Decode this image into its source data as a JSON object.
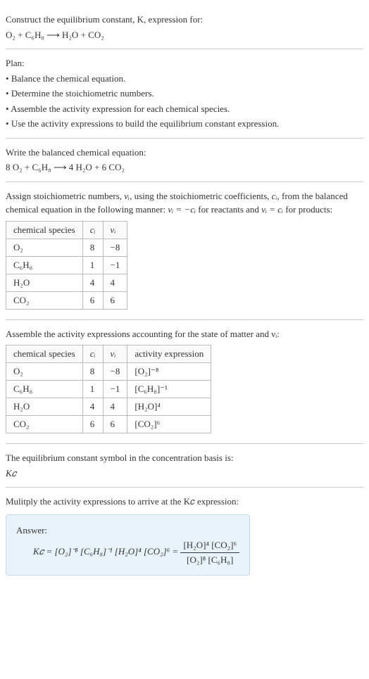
{
  "intro": {
    "title": "Construct the equilibrium constant, K, expression for:",
    "equation": "O₂ + C₆H₈ ⟶ H₂O + CO₂"
  },
  "plan": {
    "heading": "Plan:",
    "bullets": [
      "Balance the chemical equation.",
      "Determine the stoichiometric numbers.",
      "Assemble the activity expression for each chemical species.",
      "Use the activity expressions to build the equilibrium constant expression."
    ]
  },
  "balanced": {
    "heading": "Write the balanced chemical equation:",
    "equation": "8 O₂ + C₆H₈ ⟶ 4 H₂O + 6 CO₂"
  },
  "stoich": {
    "intro_a": "Assign stoichiometric numbers, ",
    "nu": "νᵢ",
    "intro_b": ", using the stoichiometric coefficients, ",
    "ci": "cᵢ",
    "intro_c": ", from the balanced chemical equation in the following manner: ",
    "rel1": "νᵢ = −cᵢ",
    "intro_d": " for reactants and ",
    "rel2": "νᵢ = cᵢ",
    "intro_e": " for products:",
    "headers": [
      "chemical species",
      "cᵢ",
      "νᵢ"
    ],
    "rows": [
      [
        "O₂",
        "8",
        "−8"
      ],
      [
        "C₆H₈",
        "1",
        "−1"
      ],
      [
        "H₂O",
        "4",
        "4"
      ],
      [
        "CO₂",
        "6",
        "6"
      ]
    ]
  },
  "activity": {
    "intro": "Assemble the activity expressions accounting for the state of matter and νᵢ:",
    "headers": [
      "chemical species",
      "cᵢ",
      "νᵢ",
      "activity expression"
    ],
    "rows": [
      [
        "O₂",
        "8",
        "−8",
        "[O₂]⁻⁸"
      ],
      [
        "C₆H₈",
        "1",
        "−1",
        "[C₆H₈]⁻¹"
      ],
      [
        "H₂O",
        "4",
        "4",
        "[H₂O]⁴"
      ],
      [
        "CO₂",
        "6",
        "6",
        "[CO₂]⁶"
      ]
    ]
  },
  "symbol": {
    "line1": "The equilibrium constant symbol in the concentration basis is:",
    "kc": "K𝑐"
  },
  "multiply": {
    "intro": "Mulitply the activity expressions to arrive at the K𝑐 expression:",
    "answer_label": "Answer:",
    "kc_eq": "K𝑐 = [O₂]⁻⁸ [C₆H₈]⁻¹ [H₂O]⁴ [CO₂]⁶ = ",
    "frac_num": "[H₂O]⁴ [CO₂]⁶",
    "frac_den": "[O₂]⁸ [C₆H₈]"
  },
  "chart_data": {
    "type": "table",
    "tables": [
      {
        "title": "Stoichiometric numbers",
        "columns": [
          "chemical species",
          "c_i",
          "ν_i"
        ],
        "rows": [
          {
            "chemical species": "O2",
            "c_i": 8,
            "ν_i": -8
          },
          {
            "chemical species": "C6H8",
            "c_i": 1,
            "ν_i": -1
          },
          {
            "chemical species": "H2O",
            "c_i": 4,
            "ν_i": 4
          },
          {
            "chemical species": "CO2",
            "c_i": 6,
            "ν_i": 6
          }
        ]
      },
      {
        "title": "Activity expressions",
        "columns": [
          "chemical species",
          "c_i",
          "ν_i",
          "activity expression"
        ],
        "rows": [
          {
            "chemical species": "O2",
            "c_i": 8,
            "ν_i": -8,
            "activity expression": "[O2]^-8"
          },
          {
            "chemical species": "C6H8",
            "c_i": 1,
            "ν_i": -1,
            "activity expression": "[C6H8]^-1"
          },
          {
            "chemical species": "H2O",
            "c_i": 4,
            "ν_i": 4,
            "activity expression": "[H2O]^4"
          },
          {
            "chemical species": "CO2",
            "c_i": 6,
            "ν_i": 6,
            "activity expression": "[CO2]^6"
          }
        ]
      }
    ]
  }
}
